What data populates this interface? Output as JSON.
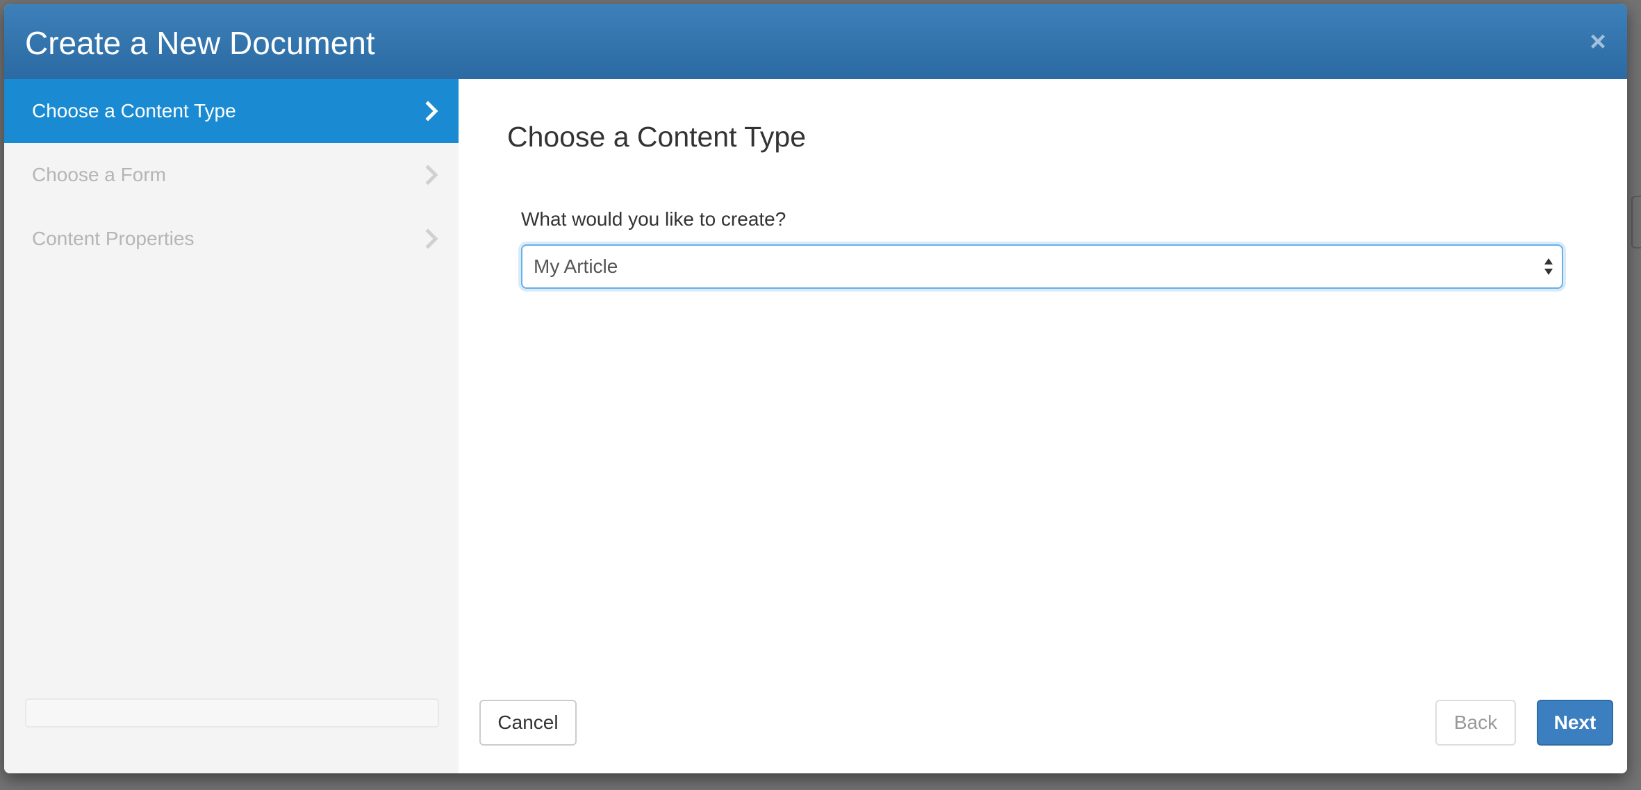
{
  "dialog": {
    "title": "Create a New Document",
    "close_glyph": "×"
  },
  "sidebar": {
    "steps": [
      {
        "label": "Choose a Content Type",
        "active": true
      },
      {
        "label": "Choose a Form",
        "active": false
      },
      {
        "label": "Content Properties",
        "active": false
      }
    ]
  },
  "main": {
    "heading": "Choose a Content Type",
    "field_label": "What would you like to create?",
    "select_value": "My Article"
  },
  "footer": {
    "cancel_label": "Cancel",
    "back_label": "Back",
    "next_label": "Next"
  },
  "colors": {
    "header": "#2f6fa8",
    "active_step": "#1a8bd2",
    "primary_button": "#3b7fc0"
  },
  "icons": {
    "close": "close-icon",
    "step_arrow": "chevron-right-icon",
    "select_arrows": "select-arrows-icon"
  }
}
